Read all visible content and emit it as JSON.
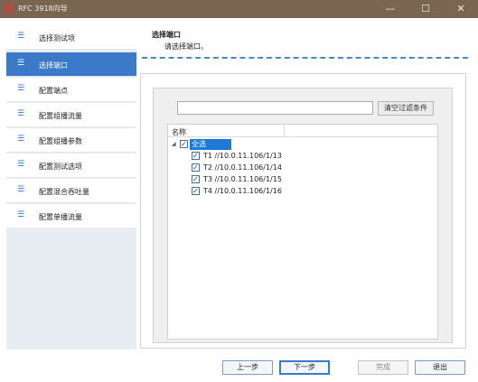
{
  "window": {
    "title": "RFC 3918向导",
    "controls": {
      "minimize": "—",
      "maximize": "☐",
      "close": "✕"
    }
  },
  "sidebar": {
    "items": [
      {
        "label": "选择测试项",
        "icon": "list-icon"
      },
      {
        "label": "选择端口",
        "icon": "list-icon",
        "active": true
      },
      {
        "label": "配置端点",
        "icon": "list-icon"
      },
      {
        "label": "配置组播流量",
        "icon": "list-icon"
      },
      {
        "label": "配置组播参数",
        "icon": "list-icon"
      },
      {
        "label": "配置测试选项",
        "icon": "list-icon"
      },
      {
        "label": "配置混合吞吐量",
        "icon": "list-icon"
      },
      {
        "label": "配置单播流量",
        "icon": "list-icon"
      }
    ]
  },
  "header": {
    "title": "选择端口",
    "subtitle": "请选择端口。"
  },
  "filter": {
    "value": "",
    "clear_label": "清空过滤条件"
  },
  "tree": {
    "column_name": "名称",
    "root": {
      "label": "全选",
      "checked": true,
      "expanded": true,
      "selected": true
    },
    "children": [
      {
        "label": "T1 //10.0.11.106/1/13",
        "checked": true
      },
      {
        "label": "T2 //10.0.11.106/1/14",
        "checked": true
      },
      {
        "label": "T3 //10.0.11.106/1/15",
        "checked": true
      },
      {
        "label": "T4 //10.0.11.106/1/16",
        "checked": true
      }
    ]
  },
  "footer": {
    "prev_label": "上一步",
    "next_label": "下一步",
    "finish_label": "完成",
    "exit_label": "退出"
  },
  "colors": {
    "titlebar": "#7a6550",
    "accent": "#3a7ac9",
    "selection": "#1d78d6"
  }
}
